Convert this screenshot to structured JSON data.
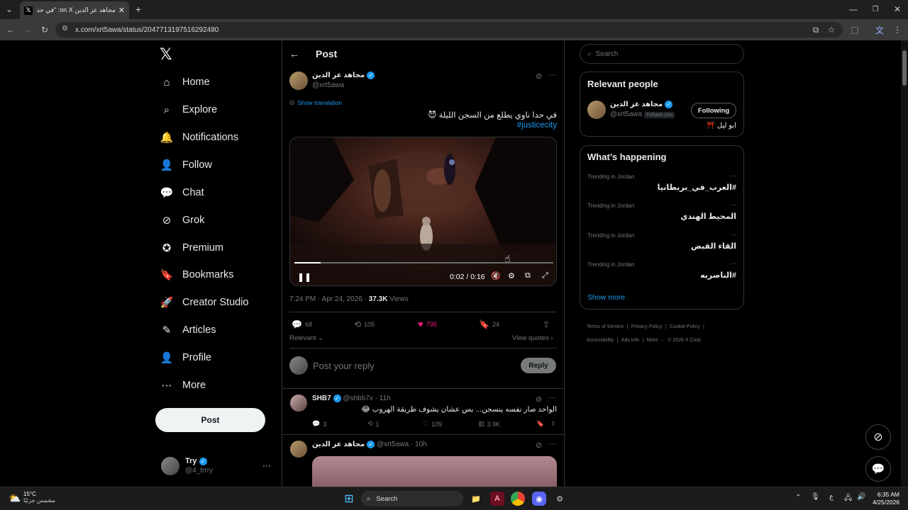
{
  "browser": {
    "tab_title": "مجاهد عز الدين on X: \"في حدا ناو",
    "url": "x.com/xrt5awa/status/2047713197516292480"
  },
  "nav": {
    "items": [
      {
        "label": "Home",
        "icon": "home-icon"
      },
      {
        "label": "Explore",
        "icon": "search-icon"
      },
      {
        "label": "Notifications",
        "icon": "bell-icon"
      },
      {
        "label": "Follow",
        "icon": "follow-icon"
      },
      {
        "label": "Chat",
        "icon": "chat-icon"
      },
      {
        "label": "Grok",
        "icon": "grok-icon"
      },
      {
        "label": "Premium",
        "icon": "premium-icon"
      },
      {
        "label": "Bookmarks",
        "icon": "bookmark-icon"
      },
      {
        "label": "Creator Studio",
        "icon": "rocket-icon"
      },
      {
        "label": "Articles",
        "icon": "article-icon"
      },
      {
        "label": "Profile",
        "icon": "profile-icon"
      },
      {
        "label": "More",
        "icon": "more-icon"
      }
    ],
    "post_label": "Post",
    "account": {
      "name": "Try",
      "handle": "@4_trrry"
    }
  },
  "post": {
    "header": "Post",
    "author_name": "مجاهد عز الدين",
    "author_handle": "@xrt5awa",
    "show_translation": "Show translation",
    "text": "في حدا ناوي يطلع من السجن الليلة 😈",
    "hashtag": "#justicecity",
    "video_time": "0:02 / 0:16",
    "video_progress": 0.1,
    "timestamp": "7:24 PM · Apr 24, 2026 · ",
    "views_count": "37.3K",
    "views_label": "Views",
    "replies": "68",
    "reposts": "105",
    "likes": "795",
    "bookmarks": "24",
    "sort_label": "Relevant",
    "view_quotes": "View quotes",
    "reply_placeholder": "Post your reply",
    "reply_button": "Reply"
  },
  "replies": [
    {
      "name": "SHB7",
      "handle": "@shbb7x",
      "time": "· 11h",
      "text": "الواحد صار نفسه ينسجن... بس عشان يشوف طريقة الهروب 😂",
      "replies": "3",
      "reposts": "1",
      "likes": "109",
      "views": "3.9K"
    },
    {
      "name": "مجاهد عز الدين",
      "handle": "@xrt5awa",
      "time": "· 10h"
    }
  ],
  "sidebar": {
    "search_placeholder": "Search",
    "relevant_title": "Relevant people",
    "person": {
      "name": "مجاهد عز الدين",
      "handle": "@xrt5awa",
      "follows_you": "Follows you",
      "bio": "ابو ليل ⛩️",
      "button": "Following"
    },
    "happening_title": "What’s happening",
    "trends": [
      {
        "context": "Trending in Jordan",
        "name": "#العرب_في_بريطانيا"
      },
      {
        "context": "Trending in Jordan",
        "name": "المحيط الهندي"
      },
      {
        "context": "Trending in Jordan",
        "name": "القاء القبض"
      },
      {
        "context": "Trending in Jordan",
        "name": "#الناصريه"
      }
    ],
    "show_more": "Show more",
    "footer": [
      "Terms of Service",
      "Privacy Policy",
      "Cookie Policy",
      "Accessibility",
      "Ads info",
      "More ···",
      "© 2026 X Corp."
    ]
  },
  "taskbar": {
    "weather_temp": "15°C",
    "weather_desc": "مشمس جزئيًا",
    "search_label": "Search",
    "time": "6:35 AM",
    "date": "4/25/2026",
    "lang": "ع"
  },
  "colors": {
    "accent": "#1d9bf0",
    "like": "#f91880"
  }
}
